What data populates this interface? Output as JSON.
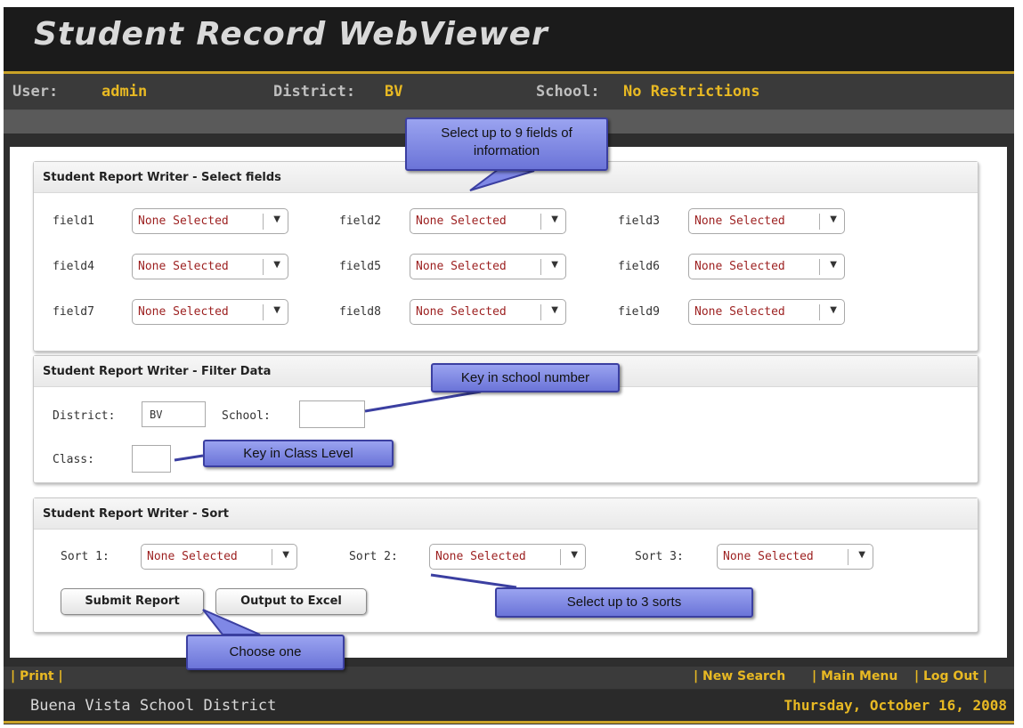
{
  "app": {
    "title": "Student Record WebViewer"
  },
  "userbar": {
    "user_label": "User:",
    "user": "admin",
    "district_label": "District:",
    "district": "BV",
    "school_label": "School:",
    "school": "No Restrictions"
  },
  "select_panel": {
    "title": "Student Report Writer - Select fields",
    "fields": [
      {
        "label": "field1",
        "value": "None Selected"
      },
      {
        "label": "field2",
        "value": "None Selected"
      },
      {
        "label": "field3",
        "value": "None Selected"
      },
      {
        "label": "field4",
        "value": "None Selected"
      },
      {
        "label": "field5",
        "value": "None Selected"
      },
      {
        "label": "field6",
        "value": "None Selected"
      },
      {
        "label": "field7",
        "value": "None Selected"
      },
      {
        "label": "field8",
        "value": "None Selected"
      },
      {
        "label": "field9",
        "value": "None Selected"
      }
    ]
  },
  "filter_panel": {
    "title": "Student Report Writer - Filter Data",
    "district_label": "District:",
    "district_value": "BV",
    "school_label": "School:",
    "school_value": "",
    "class_label": "Class:",
    "class_value": ""
  },
  "sort_panel": {
    "title": "Student Report Writer - Sort",
    "sorts": [
      {
        "label": "Sort 1:",
        "value": "None Selected"
      },
      {
        "label": "Sort 2:",
        "value": "None Selected"
      },
      {
        "label": "Sort 3:",
        "value": "None Selected"
      }
    ],
    "submit_label": "Submit Report",
    "excel_label": "Output to Excel"
  },
  "footer": {
    "print": "| Print |",
    "new_search": "| New Search",
    "main_menu": "| Main Menu",
    "log_out": "| Log Out |",
    "district_name": "Buena Vista School District",
    "date": "Thursday, October 16, 2008"
  },
  "callouts": {
    "select_fields": "Select up to 9 fields of information",
    "school_number": "Key in school number",
    "class_level": "Key in Class Level",
    "sorts": "Select up to 3 sorts",
    "choose": "Choose one"
  },
  "colors": {
    "accent": "#e8b923",
    "callout": "#7f88e6",
    "callout_border": "#3b3fa1",
    "select_value": "#9c1f1f"
  },
  "icons": {
    "dropdown": "dropdown-arrow-icon"
  }
}
